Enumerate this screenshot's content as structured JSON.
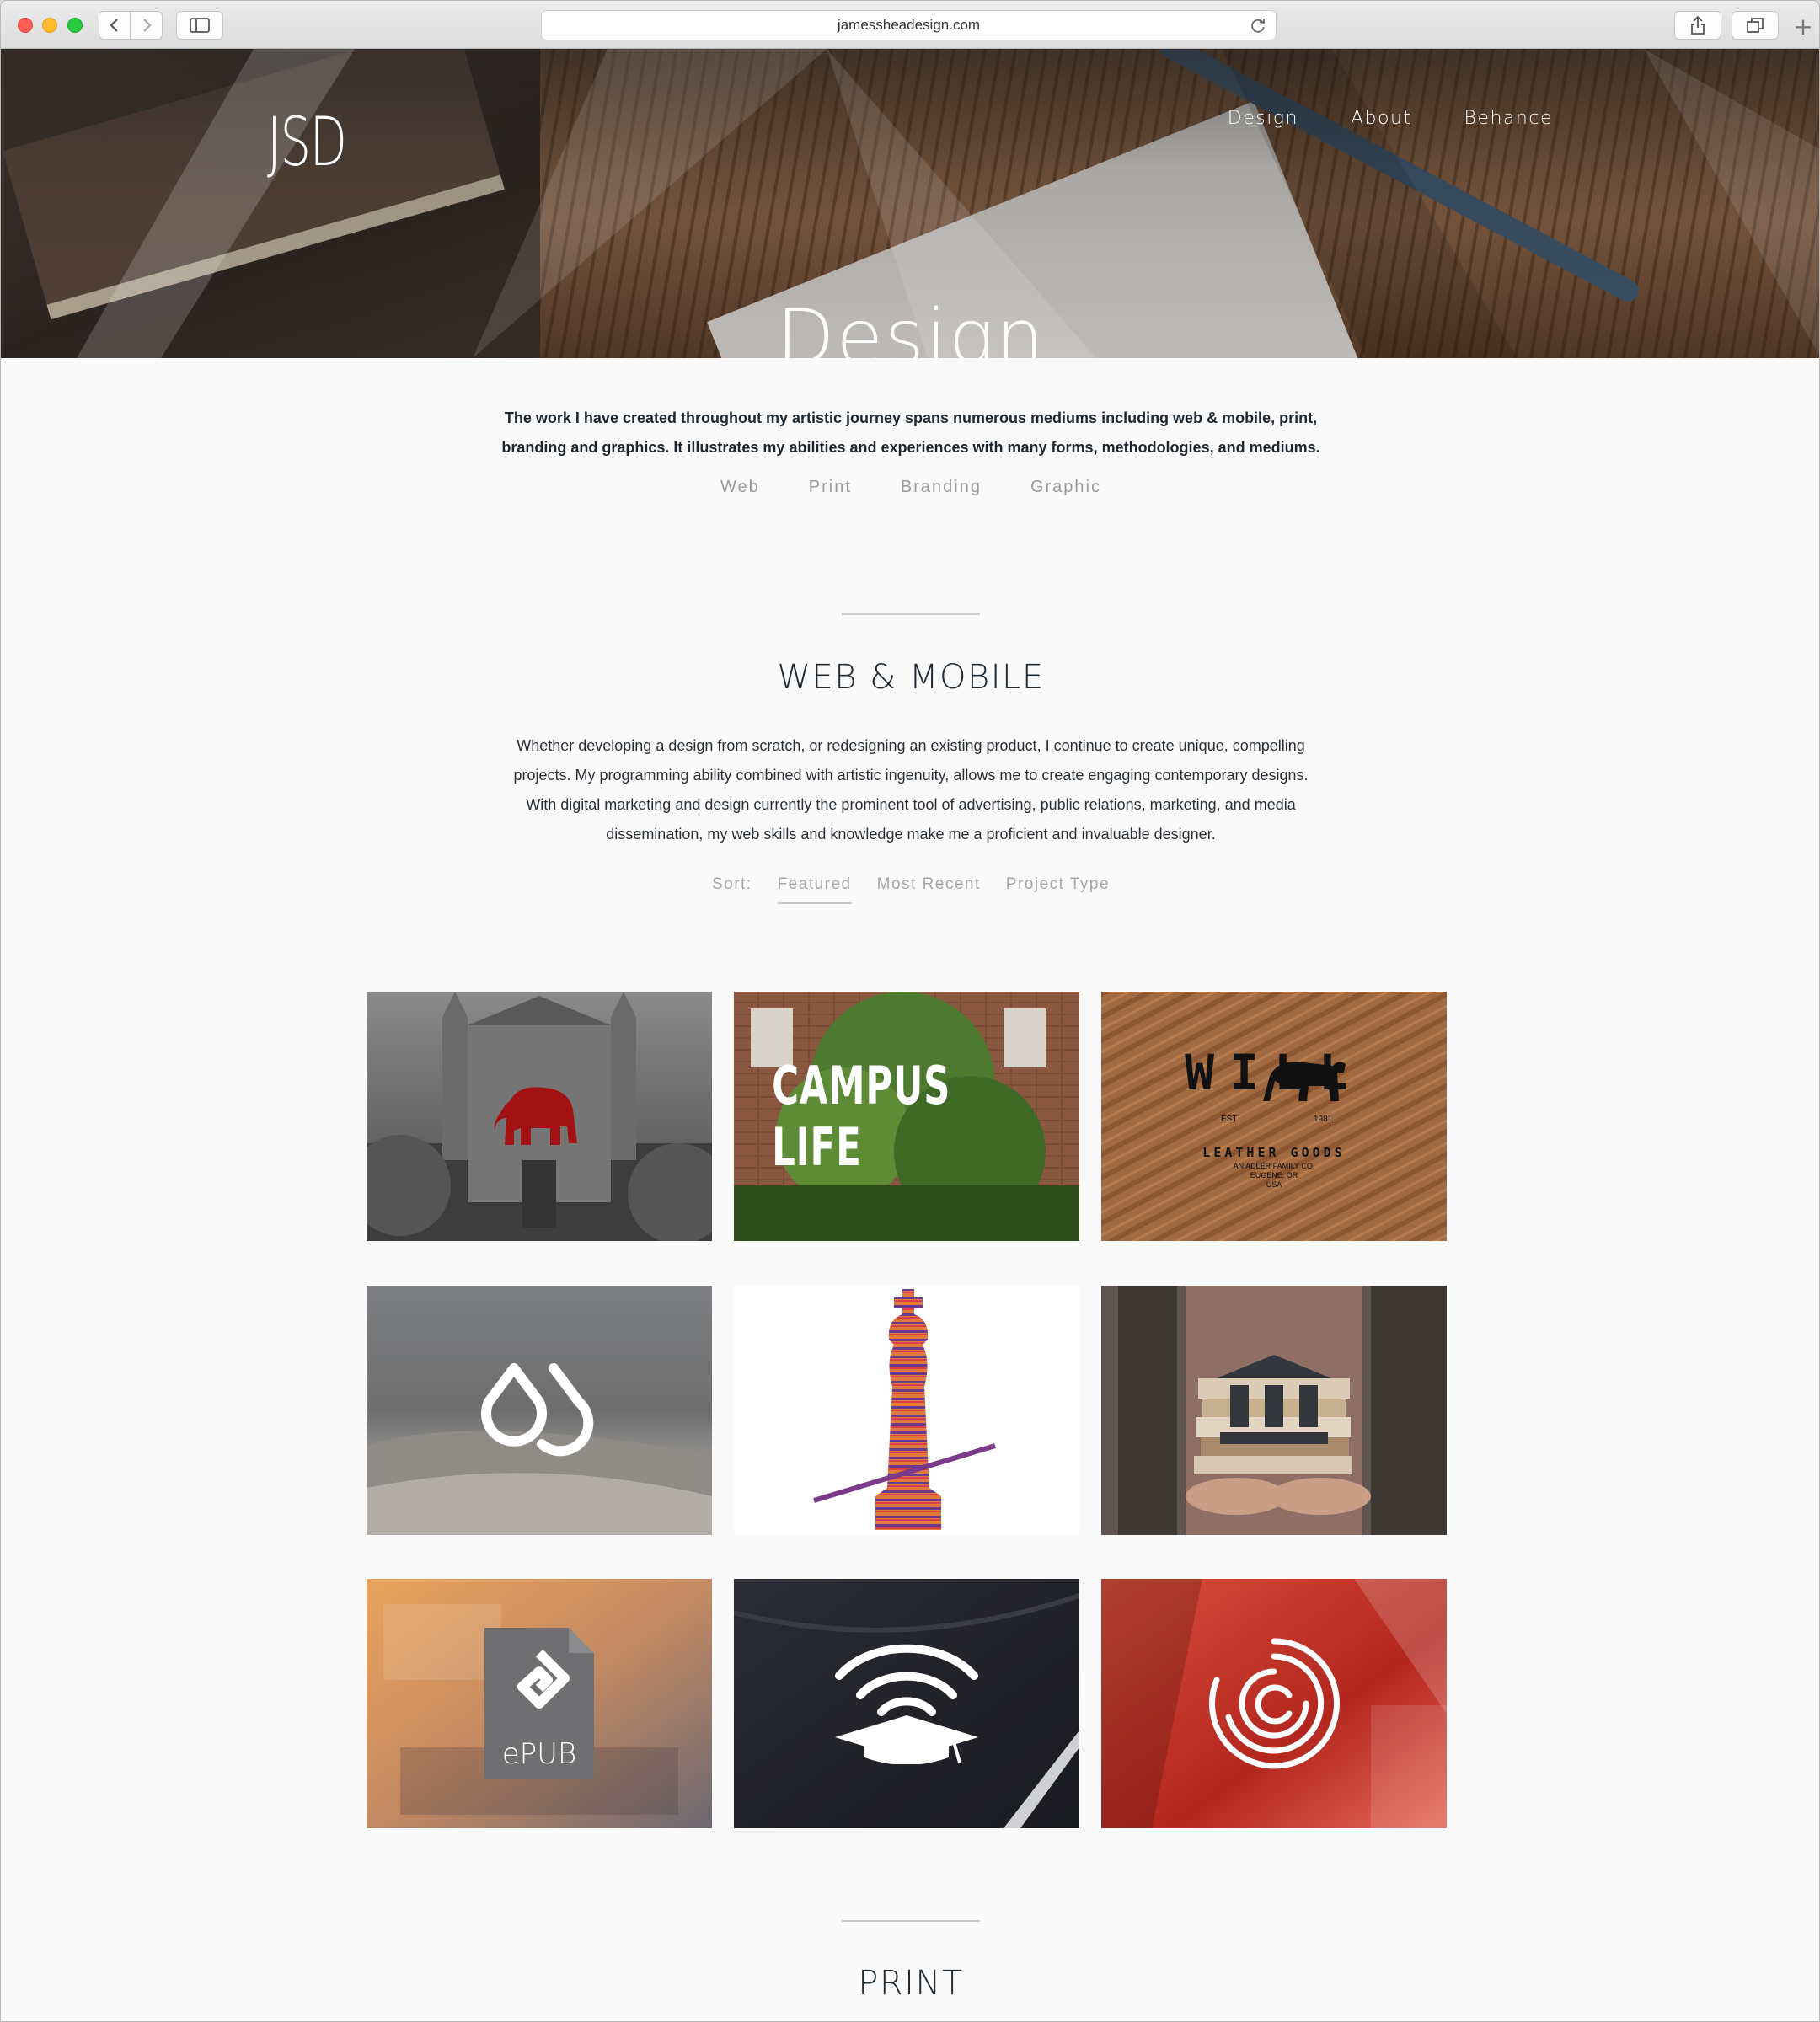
{
  "browser": {
    "url": "jamessheadesign.com"
  },
  "site": {
    "logo": "JSD",
    "nav": [
      "Design",
      "About",
      "Behance"
    ],
    "hero_title": "Design"
  },
  "intro": {
    "line1": "The work I have created throughout my artistic journey spans numerous mediums including web & mobile, print,",
    "line2": "branding and graphics. It illustrates my abilities and experiences with many forms, methodologies, and mediums.",
    "categories": [
      "Web",
      "Print",
      "Branding",
      "Graphic"
    ]
  },
  "web_section": {
    "title": "WEB & MOBILE",
    "desc": [
      "Whether developing a design from scratch, or redesigning an existing product, I continue to create unique, compelling",
      "projects. My programming ability combined with artistic ingenuity, allows me to create engaging contemporary designs.",
      "With digital marketing and design currently the prominent tool of advertising, public relations, marketing, and media",
      "dissemination, my web skills and knowledge make me a proficient and invaluable designer."
    ],
    "sort_label": "Sort:",
    "sort_options": [
      "Featured",
      "Most Recent",
      "Project Type"
    ],
    "sort_active": "Featured"
  },
  "projects": [
    {
      "name": "elephant-campus-project"
    },
    {
      "name": "campus-life-project",
      "label": "CAMPUS LIFE"
    },
    {
      "name": "will-leather-goods-project",
      "brand": "WILL",
      "sub": "LEATHER GOODS",
      "small1": "EST",
      "small2": "1981",
      "small3": "AN ADLER FAMILY CO.",
      "small4": "EUGENE, OR",
      "small5": "USA"
    },
    {
      "name": "droplet-logo-project"
    },
    {
      "name": "chess-king-project"
    },
    {
      "name": "library-books-project"
    },
    {
      "name": "epub-project",
      "label": "ePUB"
    },
    {
      "name": "graduation-wifi-project"
    },
    {
      "name": "red-circles-project"
    }
  ],
  "print_section": {
    "title": "PRINT"
  }
}
